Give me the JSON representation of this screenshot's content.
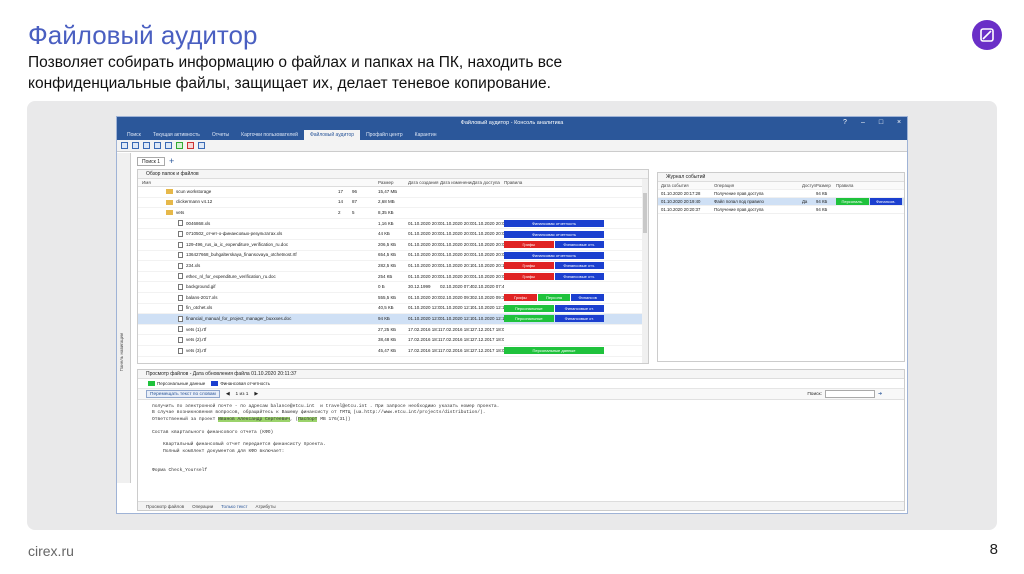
{
  "slide": {
    "title": "Файловый аудитор",
    "subtitle": "Позволяет собирать информацию о файлах и папках на ПК, находить все конфиденциальные файлы, защищает их, делает теневое копирование.",
    "site": "cirex.ru",
    "page": "8"
  },
  "app": {
    "window_title": "Файловый аудитор - Консоль аналитика",
    "tabs": [
      "Поиск",
      "Текущая активность",
      "Отчеты",
      "Карточки пользователей",
      "Файловый аудитор",
      "Профайл центр",
      "Карантин"
    ],
    "active_tab": 4,
    "left_strip_label": "Панель навигации",
    "subtab": "Поиск 1",
    "files_pane_title": "Обзор папок и файлов",
    "columns": [
      "Имя",
      "Размер",
      "Дата создания",
      "Дата изменения",
      "Дата доступа",
      "Правила"
    ],
    "rows": [
      {
        "name": "scun workstorage",
        "folder": true,
        "n1": "17",
        "n2": "96",
        "size": "15,47 МБ",
        "cr": "",
        "ch": "",
        "ac": "",
        "tags": []
      },
      {
        "name": "clickermann v4.12",
        "folder": true,
        "n1": "14",
        "n2": "87",
        "size": "2,68 МБ",
        "cr": "",
        "ch": "",
        "ac": "",
        "tags": []
      },
      {
        "name": "vets",
        "folder": true,
        "n1": "2",
        "n2": "5",
        "size": "8,35 КБ",
        "cr": "",
        "ch": "",
        "ac": "",
        "tags": []
      },
      {
        "name": "0046868.xls",
        "folder": false,
        "n1": "",
        "n2": "",
        "size": "1,16 КБ",
        "cr": "01.10.2020 20:09",
        "ch": "01.10.2020 20:09",
        "ac": "01.10.2020 20:09",
        "tags": [
          {
            "t": "Финансовая отчетность",
            "c": "blue"
          }
        ]
      },
      {
        "name": "0710502_отчет-о-финансовых-результатах.xls",
        "folder": false,
        "n1": "",
        "n2": "",
        "size": "44 КБ",
        "cr": "01.10.2020 20:09",
        "ch": "01.10.2020 20:09",
        "ac": "01.10.2020 20:09",
        "tags": [
          {
            "t": "Финансовая отчетность",
            "c": "blue"
          }
        ]
      },
      {
        "name": "129-496_rus_ia_ic_expenditure_verification_ru.doc",
        "folder": false,
        "n1": "",
        "n2": "",
        "size": "206,5 КБ",
        "cr": "01.10.2020 20:09",
        "ch": "01.10.2020 20:09",
        "ac": "01.10.2020 20:09",
        "tags": [
          {
            "t": "Грифы",
            "c": "red"
          },
          {
            "t": "Финансовые отч.",
            "c": "blue"
          }
        ]
      },
      {
        "name": "136427668_buhgalterskaya_finansovaya_otchetnost.rtf",
        "folder": false,
        "n1": "",
        "n2": "",
        "size": "654,5 КБ",
        "cr": "01.10.2020 20:09",
        "ch": "01.10.2020 20:09",
        "ac": "01.10.2020 20:09",
        "tags": [
          {
            "t": "Финансовая отчетность",
            "c": "blue"
          }
        ]
      },
      {
        "name": "234.xls",
        "folder": false,
        "n1": "",
        "n2": "",
        "size": "282,5 КБ",
        "cr": "01.10.2020 20:09",
        "ch": "01.10.2020 20:14",
        "ac": "01.10.2020 20:14",
        "tags": [
          {
            "t": "Грифы",
            "c": "red"
          },
          {
            "t": "Финансовые отч.",
            "c": "blue"
          }
        ]
      },
      {
        "name": "ethec_nl_for_expenditure_verification_ru.doc",
        "folder": false,
        "n1": "",
        "n2": "",
        "size": "254 КБ",
        "cr": "01.10.2020 20:09",
        "ch": "01.10.2020 20:09",
        "ac": "01.10.2020 20:09",
        "tags": [
          {
            "t": "Грифы",
            "c": "red"
          },
          {
            "t": "Финансовые отч.",
            "c": "blue"
          }
        ]
      },
      {
        "name": "background.gif",
        "folder": false,
        "n1": "",
        "n2": "",
        "size": "0 Б",
        "cr": "30.12.1999",
        "ch": "02.10.2020 07:47",
        "ac": "02.10.2020 07:47",
        "tags": []
      },
      {
        "name": "balans-2017.xls",
        "folder": false,
        "n1": "",
        "n2": "",
        "size": "555,5 КБ",
        "cr": "01.10.2020 20:09",
        "ch": "02.10.2020 09:34",
        "ac": "02.10.2020 09:34",
        "tags": [
          {
            "t": "Грифы",
            "c": "red"
          },
          {
            "t": "Персона",
            "c": "green"
          },
          {
            "t": "Финансов",
            "c": "blue"
          }
        ]
      },
      {
        "name": "fin_otchet.xls",
        "folder": false,
        "n1": "",
        "n2": "",
        "size": "40,5 КБ",
        "cr": "01.10.2020 12:05",
        "ch": "01.10.2020 12:13",
        "ac": "01.10.2020 12:13",
        "tags": [
          {
            "t": "Персональные",
            "c": "green"
          },
          {
            "t": "Финансовые от.",
            "c": "blue"
          }
        ]
      },
      {
        "name": "financial_manual_for_project_manager_buxxxes.doc",
        "folder": false,
        "n1": "",
        "n2": "",
        "size": "94 КБ",
        "cr": "01.10.2020 12:09",
        "ch": "01.10.2020 12:11",
        "ac": "01.10.2020 12:11",
        "tags": [
          {
            "t": "Персональные",
            "c": "green"
          },
          {
            "t": "Финансовые от.",
            "c": "blue"
          }
        ],
        "selected": true
      },
      {
        "name": "vets (1).rtf",
        "folder": false,
        "n1": "",
        "n2": "",
        "size": "27,25 КБ",
        "cr": "17.02.2016 18:13",
        "ch": "17.02.2016 18:13",
        "ac": "27.12.2017 18:05",
        "tags": []
      },
      {
        "name": "vets (2).rtf",
        "folder": false,
        "n1": "",
        "n2": "",
        "size": "38,48 КБ",
        "cr": "17.02.2016 18:13",
        "ch": "17.02.2016 18:13",
        "ac": "27.12.2017 18:05",
        "tags": []
      },
      {
        "name": "vets (3).rtf",
        "folder": false,
        "n1": "",
        "n2": "",
        "size": "45,47 КБ",
        "cr": "17.02.2016 18:13",
        "ch": "17.02.2016 18:13",
        "ac": "27.12.2017 18:05",
        "tags": [
          {
            "t": "Персональные данные",
            "c": "green"
          }
        ]
      }
    ],
    "journal": {
      "title": "Журнал событий",
      "columns": [
        "Дата события",
        "Операция",
        "Доступ",
        "Размер",
        "Правила"
      ],
      "rows": [
        {
          "dt": "01.10.2020 20:17:28",
          "op": "Получение прав доступа",
          "ac": "",
          "sz": "94 КБ",
          "tags": []
        },
        {
          "dt": "01.10.2020 20:19:40",
          "op": "Файл попал под правило",
          "ac": "Да",
          "sz": "94 КБ",
          "tags": [
            {
              "t": "Персональ.",
              "c": "green"
            },
            {
              "t": "Финансов.",
              "c": "blue"
            }
          ],
          "selected": true
        },
        {
          "dt": "01.10.2020 20:20:37",
          "op": "Получение прав доступа",
          "ac": "",
          "sz": "94 КБ",
          "tags": []
        }
      ]
    },
    "viewer": {
      "title": "Просмотр файлов - Дата обновления файла 01.10.2020 20:11:37",
      "legend": [
        {
          "label": "Персональные данные",
          "color": "#1fc23c"
        },
        {
          "label": "Финансовая отчетность",
          "color": "#1b3fcf"
        }
      ],
      "btn_move": "Перемещать текст по словам",
      "page_of": "1 из 1",
      "search_label": "Поиск:",
      "text_lines": [
        "получить по электронной почте - по адресам balance@etcu.int  и travel@etcu.int . При запросе необходимо указать номер проекта.",
        "В случае возникновения вопросов, обращайтесь к Вашему финансисту от ГМТЦ (ua.http://www.etcu.int/projects/distribution/).",
        "Ответственный за проект "
      ],
      "text_hl": "Иванов Александр Сергеевич",
      "text_hl2": "Паспорт",
      "text_after": " МВ 176(31))",
      "text_lines2": [
        "",
        "Состав квартального финансового отчета (КФО)",
        "",
        "    Квартальный финансовый отчет передается финансисту проекта.",
        "    Полный комплект документов для КФО включает:",
        "",
        "",
        "Форма Check_Yourself"
      ],
      "bottom_tabs": [
        "Просмотр файлов",
        "Операции",
        "Только текст",
        "Атрибуты"
      ],
      "bottom_active": 2
    }
  }
}
